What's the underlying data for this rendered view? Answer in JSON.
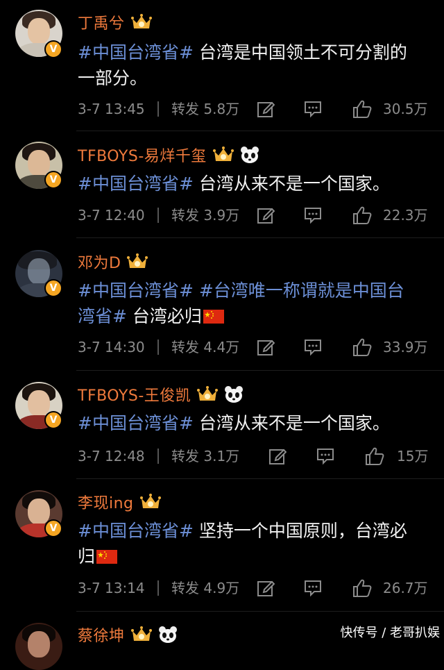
{
  "posts": [
    {
      "name": "丁禹兮",
      "has_panda": false,
      "tags": [
        "#中国台湾省#"
      ],
      "text_line1": " 台湾是中国领土不可分割的",
      "text_line2": "一部分。",
      "time": "3-7 13:45",
      "repost": "转发 5.8万",
      "likes": "30.5万"
    },
    {
      "name": "TFBOYS-易烊千玺",
      "has_panda": true,
      "tags": [
        "#中国台湾省#"
      ],
      "text": " 台湾从来不是一个国家。",
      "time": "3-7 12:40",
      "repost": "转发 3.9万",
      "likes": "22.3万"
    },
    {
      "name": "邓为D",
      "has_panda": false,
      "tags": [
        "#中国台湾省#",
        "#台湾唯一称谓就是中国台",
        "湾省#"
      ],
      "text": " 台湾必归",
      "time": "3-7 14:30",
      "repost": "转发 4.4万",
      "likes": "33.9万"
    },
    {
      "name": "TFBOYS-王俊凯",
      "has_panda": true,
      "tags": [
        "#中国台湾省#"
      ],
      "text": " 台湾从来不是一个国家。",
      "time": "3-7 12:48",
      "repost": "转发 3.1万",
      "likes": "15万"
    },
    {
      "name": "李现ing",
      "has_panda": false,
      "tags": [
        "#中国台湾省#"
      ],
      "text_line1": " 坚持一个中国原则，台湾必",
      "text_line2": "归",
      "time": "3-7 13:14",
      "repost": "转发 4.9万",
      "likes": "26.7万"
    },
    {
      "name": "蔡徐坤",
      "has_panda": true
    }
  ],
  "watermark": "快传号 / 老哥扒娱",
  "colors": {
    "name": "#ef7a3c",
    "tag": "#6c8fd6",
    "meta": "#8c8c8c",
    "verified_badge": "#f5a623"
  },
  "icons": {
    "verified": "v-badge-icon",
    "member_crown": "crown-icon",
    "panda": "panda-icon",
    "flag": "china-flag-icon",
    "repost_edit": "edit-icon",
    "comment": "comment-icon",
    "like": "thumbs-up-icon"
  }
}
